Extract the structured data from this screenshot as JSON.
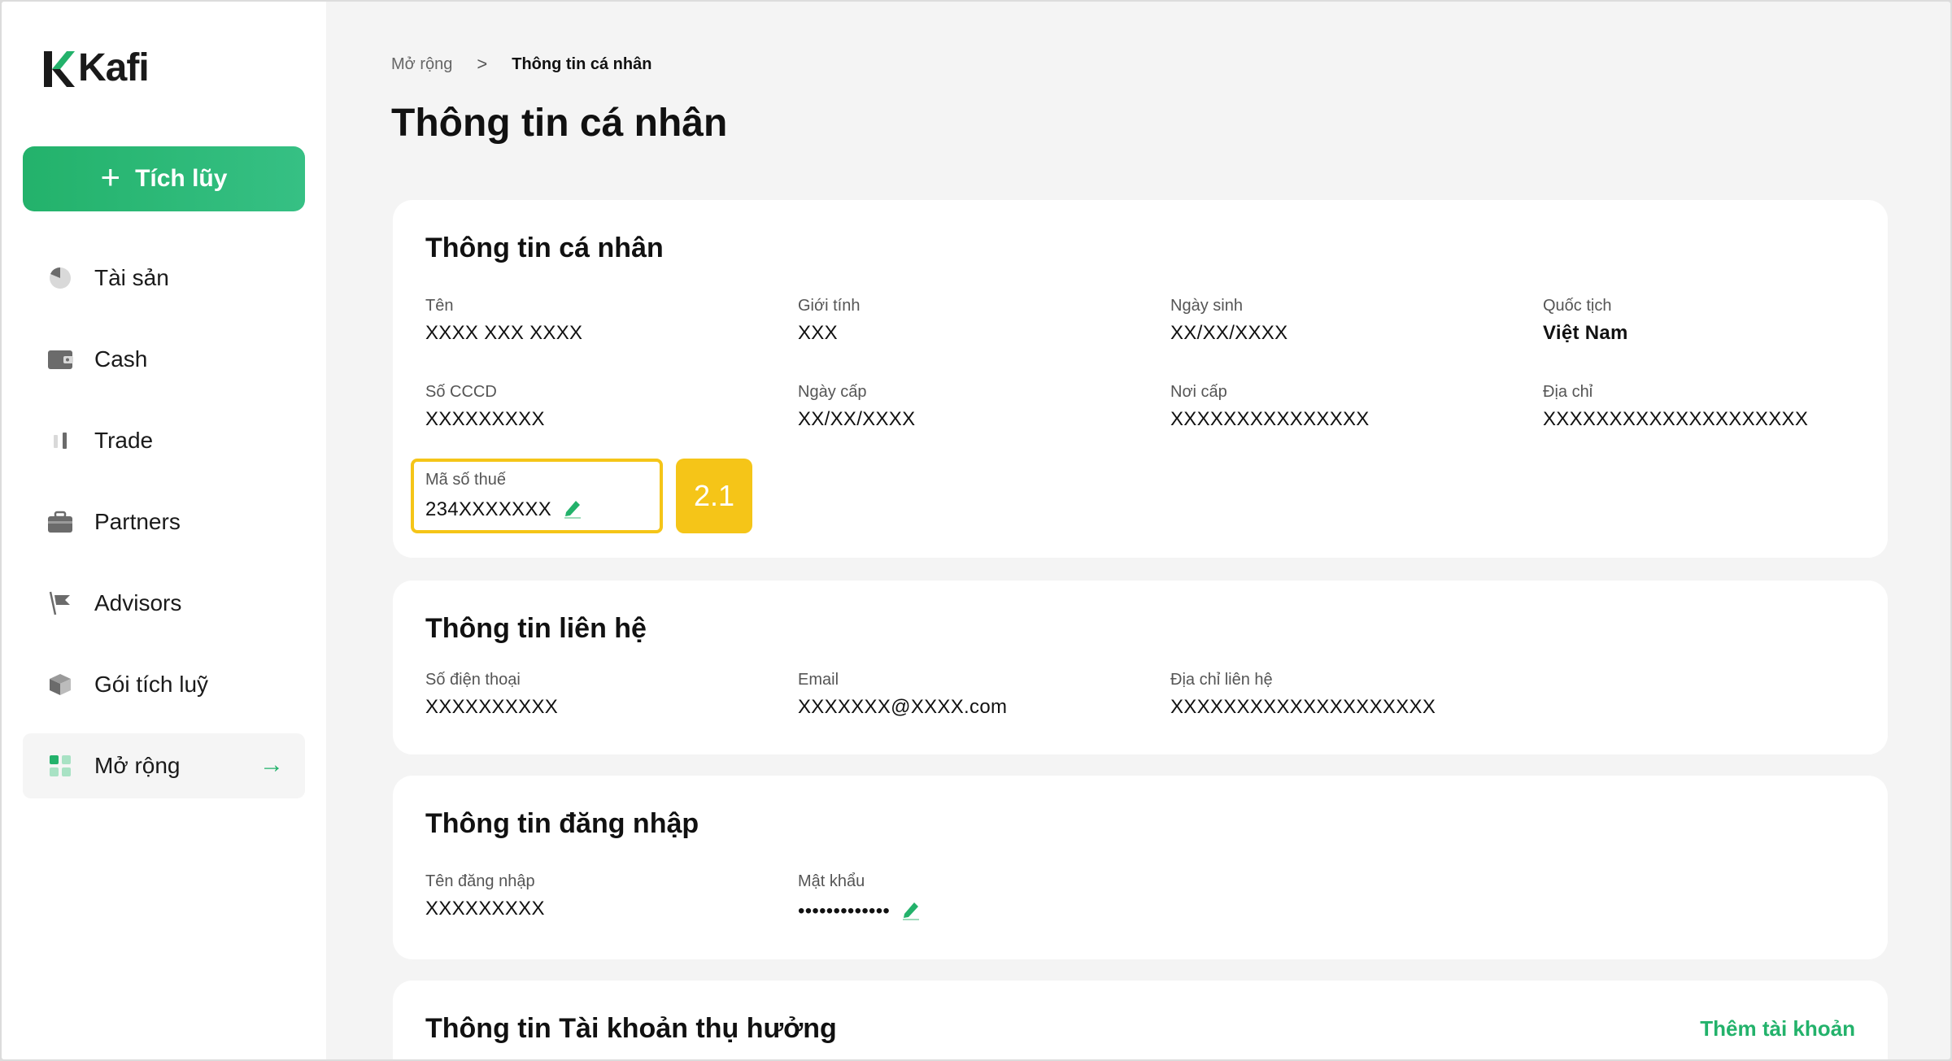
{
  "brand": {
    "name": "Kafi",
    "accent_color": "#23b26b",
    "highlight_color": "#f5c518"
  },
  "sidebar": {
    "primary_button": {
      "label": "Tích lũy",
      "icon": "plus-icon"
    },
    "items": [
      {
        "label": "Tài sản",
        "icon": "pie-chart-icon"
      },
      {
        "label": "Cash",
        "icon": "wallet-icon"
      },
      {
        "label": "Trade",
        "icon": "candlestick-icon"
      },
      {
        "label": "Partners",
        "icon": "briefcase-icon"
      },
      {
        "label": "Advisors",
        "icon": "flag-icon"
      },
      {
        "label": "Gói tích luỹ",
        "icon": "package-icon"
      },
      {
        "label": "Mở rộng",
        "icon": "grid-icon",
        "active": true
      }
    ]
  },
  "breadcrumb": {
    "parent": "Mở rộng",
    "separator": ">",
    "current": "Thông tin cá nhân"
  },
  "page_title": "Thông tin cá nhân",
  "personal_info": {
    "title": "Thông tin cá nhân",
    "fields": [
      {
        "label": "Tên",
        "value": "XXXX XXX XXXX"
      },
      {
        "label": "Giới tính",
        "value": "XXX"
      },
      {
        "label": "Ngày sinh",
        "value": "XX/XX/XXXX"
      },
      {
        "label": "Quốc tịch",
        "value": "Việt Nam"
      },
      {
        "label": "Số CCCD",
        "value": "XXXXXXXXX"
      },
      {
        "label": "Ngày cấp",
        "value": "XX/XX/XXXX"
      },
      {
        "label": "Nơi cấp",
        "value": "XXXXXXXXXXXXXXX"
      },
      {
        "label": "Địa chỉ",
        "value": "XXXXXXXXXXXXXXXXXXXX"
      }
    ],
    "tax_code": {
      "label": "Mã số thuế",
      "value": "234XXXXXXX"
    },
    "step_badge": "2.1"
  },
  "contact_info": {
    "title": "Thông tin liên hệ",
    "fields": [
      {
        "label": "Số điện thoại",
        "value": "XXXXXXXXXX"
      },
      {
        "label": "Email",
        "value": "XXXXXXX@XXXX.com"
      },
      {
        "label": "Địa chỉ liên hệ",
        "value": "XXXXXXXXXXXXXXXXXXXX"
      }
    ]
  },
  "login_info": {
    "title": "Thông tin đăng nhập",
    "fields": [
      {
        "label": "Tên đăng nhập",
        "value": "XXXXXXXXX"
      },
      {
        "label": "Mật khẩu",
        "value": "•••••••••••••"
      }
    ]
  },
  "beneficiary": {
    "title": "Thông tin Tài khoản thụ hưởng",
    "add_link": "Thêm tài khoản"
  }
}
